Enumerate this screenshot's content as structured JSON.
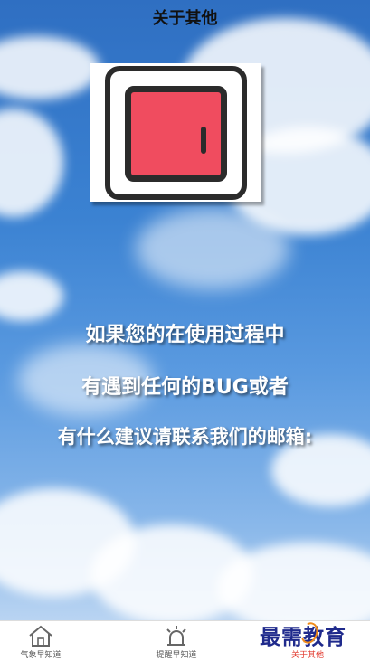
{
  "header": {
    "title": "关于其他"
  },
  "logo": {
    "icon": "door-icon",
    "door_color": "#f04c5f"
  },
  "message": {
    "line1": "如果您的在使用过程中",
    "line2": "有遇到任何的BUG或者",
    "line3": "有什么建议请联系我们的邮箱:"
  },
  "tabbar": {
    "tabs": [
      {
        "label": "气象早知道",
        "icon": "home-icon",
        "active": false
      },
      {
        "label": "提醒早知道",
        "icon": "alarm-light-icon",
        "active": false
      },
      {
        "label": "关于其他",
        "icon": "info-icon",
        "active": true
      }
    ],
    "active_color": "#e23a2e"
  },
  "watermark": {
    "text": "最需教育"
  }
}
